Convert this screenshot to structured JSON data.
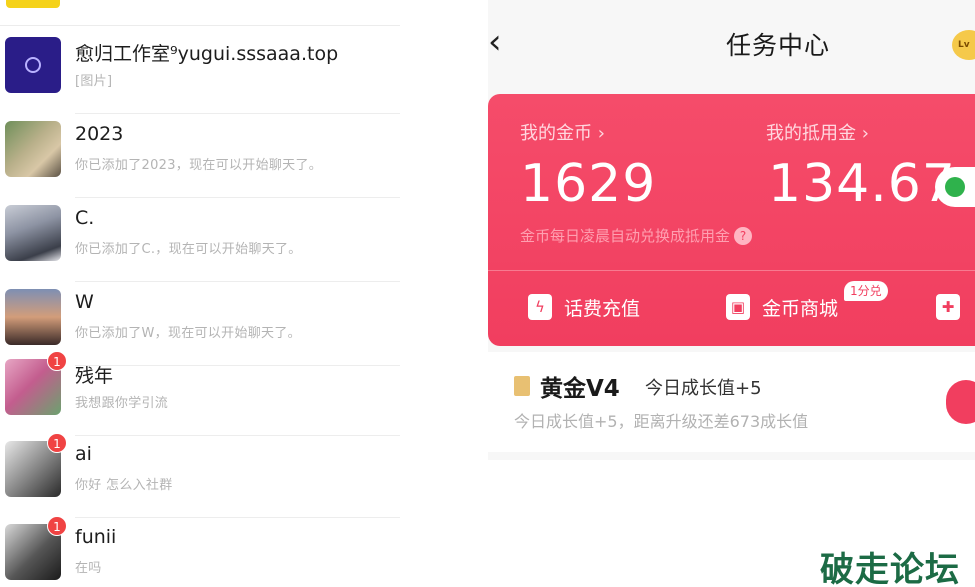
{
  "chats": [
    {
      "name": "愈归工作室⁹yugui.sssaaa.top",
      "preview": "[图片]",
      "badge": ""
    },
    {
      "name": "2023",
      "preview": "你已添加了2023，现在可以开始聊天了。",
      "badge": ""
    },
    {
      "name": "C.",
      "preview": "你已添加了C.，现在可以开始聊天了。",
      "badge": ""
    },
    {
      "name": "W",
      "preview": "你已添加了W，现在可以开始聊天了。",
      "badge": ""
    },
    {
      "name": "残年",
      "preview": "我想跟你学引流",
      "badge": "1"
    },
    {
      "name": "ai",
      "preview": "你好 怎么入社群",
      "badge": "1"
    },
    {
      "name": "funii",
      "preview": "在吗",
      "badge": "1"
    }
  ],
  "task_center": {
    "back": "‹",
    "title": "任务中心",
    "level_badge": "Lv",
    "coins_label": "我的金币 ›",
    "coins_value": "1629",
    "deduct_label": "我的抵用金 ›",
    "deduct_value": "134.67",
    "hint": "金币每日凌晨自动兑换成抵用金",
    "help": "?",
    "actions": [
      {
        "label": "话费充值",
        "icon": "ϟ"
      },
      {
        "label": "金币商城",
        "icon": "▣"
      },
      {
        "label": "",
        "icon": "✚"
      }
    ],
    "mall_tag": "1分兑",
    "level": {
      "name": "黄金V4",
      "today": "今日成长值+5",
      "sub": "今日成长值+5，距离升级还差673成长值"
    }
  },
  "watermark": "破走论坛",
  "colors": {
    "accent": "#f13e5f",
    "badge": "#f04343",
    "watermark": "#1c6b45"
  }
}
